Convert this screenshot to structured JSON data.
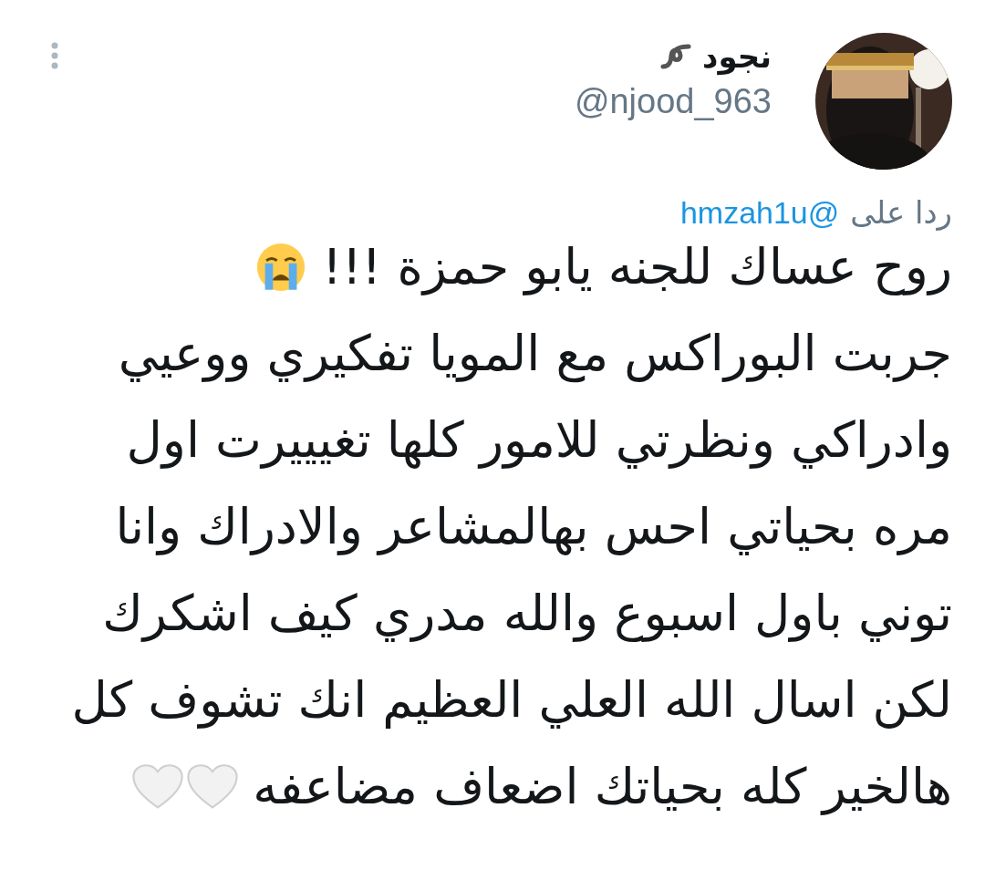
{
  "author": {
    "name": "نجود",
    "handle": "@njood_963"
  },
  "reply": {
    "prefix": "ردا على",
    "mention": "@hmzah1u"
  },
  "body": [
    {
      "text": "روح عساك للجنه يابو حمزة !!!",
      "kind": "crying"
    },
    {
      "text": "جربت البوراكس مع المويا تفكيري ووعيي"
    },
    {
      "text": "وادراكي ونظرتي للامور كلها تغيييرت اول"
    },
    {
      "text": "مره بحياتي احس بهالمشاعر والادراك وانا"
    },
    {
      "text": "توني باول اسبوع والله مدري كيف اشكرك"
    },
    {
      "text": "لكن اسال الله العلي العظيم انك تشوف كل"
    },
    {
      "text": "هالخير كله بحياتك اضعاف مضاعفه",
      "kind": "hearts"
    }
  ]
}
